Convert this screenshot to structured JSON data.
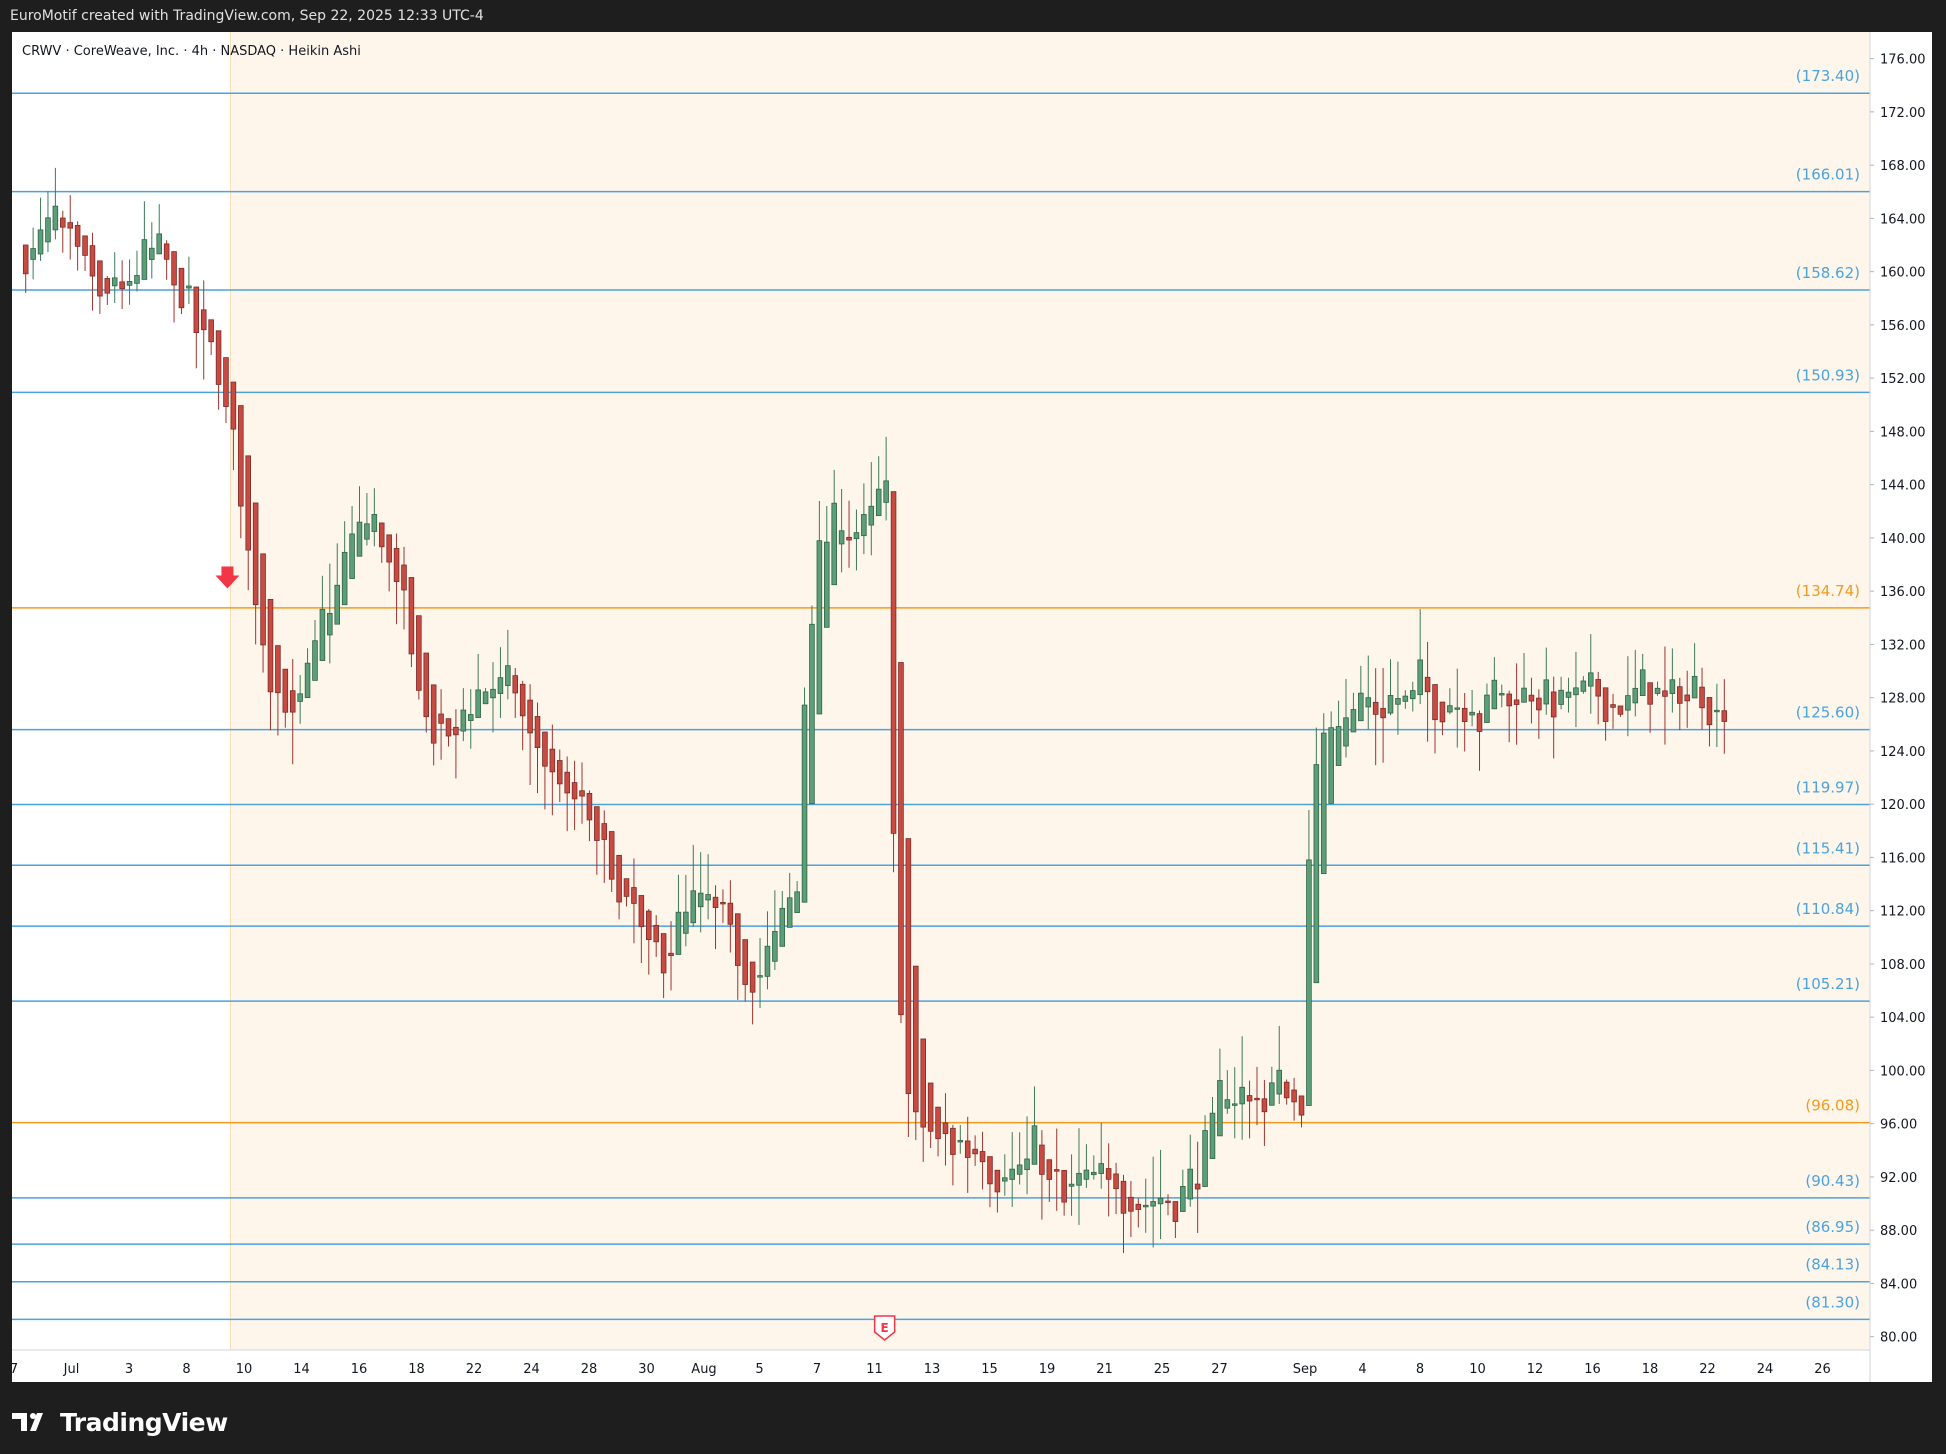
{
  "header": {
    "caption": "EuroMotif created with TradingView.com, Sep 22, 2025 12:33 UTC-4"
  },
  "symbol_line": "CRWV · CoreWeave, Inc. · 4h · NASDAQ · Heikin Ashi",
  "footer": {
    "brand": "TradingView"
  },
  "colors": {
    "background": "#ffffff",
    "frame": "#1e1e1e",
    "highlight_zone": "#fff6eb",
    "level_blue": "#4aa3df",
    "level_orange": "#f59a1e",
    "candle_up": "#5b9e78",
    "candle_down": "#c84b43",
    "signal_arrow": "#f23645"
  },
  "chart_data": {
    "type": "candlestick",
    "title": "CRWV · CoreWeave, Inc. · 4h · NASDAQ · Heikin Ashi",
    "candle_style": "Heikin Ashi",
    "interval": "4h",
    "ylim": [
      79,
      178
    ],
    "y_ticks": [
      "176.00",
      "172.00",
      "168.00",
      "164.00",
      "160.00",
      "156.00",
      "152.00",
      "148.00",
      "144.00",
      "140.00",
      "136.00",
      "132.00",
      "128.00",
      "124.00",
      "120.00",
      "116.00",
      "112.00",
      "108.00",
      "104.00",
      "100.00",
      "96.00",
      "92.00",
      "88.00",
      "84.00",
      "80.00"
    ],
    "x_ticks": [
      "7",
      "Jul",
      "3",
      "8",
      "10",
      "14",
      "16",
      "18",
      "22",
      "24",
      "28",
      "30",
      "Aug",
      "5",
      "7",
      "11",
      "13",
      "15",
      "19",
      "21",
      "25",
      "27",
      "Sep",
      "4",
      "8",
      "10",
      "12",
      "16",
      "18",
      "22",
      "24",
      "26"
    ],
    "levels": [
      {
        "value": 173.4,
        "label": "(173.40)",
        "color": "blue"
      },
      {
        "value": 166.01,
        "label": "(166.01)",
        "color": "blue"
      },
      {
        "value": 158.62,
        "label": "(158.62)",
        "color": "blue"
      },
      {
        "value": 150.93,
        "label": "(150.93)",
        "color": "blue"
      },
      {
        "value": 134.74,
        "label": "(134.74)",
        "color": "orange"
      },
      {
        "value": 125.6,
        "label": "(125.60)",
        "color": "blue"
      },
      {
        "value": 119.97,
        "label": "(119.97)",
        "color": "blue"
      },
      {
        "value": 115.41,
        "label": "(115.41)",
        "color": "blue"
      },
      {
        "value": 110.84,
        "label": "(110.84)",
        "color": "blue"
      },
      {
        "value": 105.21,
        "label": "(105.21)",
        "color": "blue"
      },
      {
        "value": 96.08,
        "label": "(96.08)",
        "color": "orange"
      },
      {
        "value": 90.43,
        "label": "(90.43)",
        "color": "blue"
      },
      {
        "value": 86.95,
        "label": "(86.95)",
        "color": "blue"
      },
      {
        "value": 84.13,
        "label": "(84.13)",
        "color": "blue"
      },
      {
        "value": 81.3,
        "label": "(81.30)",
        "color": "blue"
      }
    ],
    "highlight_zone_from": "11",
    "signal_arrow": {
      "direction": "down",
      "price": 136.5
    },
    "earnings_marker": {
      "label": "E",
      "at": "12"
    },
    "anchors": [
      [
        "start",
        162
      ],
      [
        "Jul",
        163
      ],
      [
        "3",
        158
      ],
      [
        "4",
        157
      ],
      [
        "8",
        162
      ],
      [
        "9",
        158
      ],
      [
        "10",
        154
      ],
      [
        "11",
        145
      ],
      [
        "13",
        130
      ],
      [
        "14",
        126
      ],
      [
        "15",
        134
      ],
      [
        "16",
        141
      ],
      [
        "17",
        140
      ],
      [
        "18",
        128
      ],
      [
        "21",
        124
      ],
      [
        "22",
        128
      ],
      [
        "23",
        130
      ],
      [
        "24",
        124
      ],
      [
        "28",
        117
      ],
      [
        "29",
        112
      ],
      [
        "30",
        107
      ],
      [
        "31",
        111
      ],
      [
        "Aug",
        112
      ],
      [
        "5",
        106
      ],
      [
        "6",
        110
      ],
      [
        "7",
        113
      ],
      [
        "8",
        118
      ],
      [
        "11",
        130
      ],
      [
        "12",
        142
      ],
      [
        "13",
        133
      ],
      [
        "14",
        120
      ],
      [
        "15",
        100
      ],
      [
        "18",
        101
      ],
      [
        "19",
        93
      ],
      [
        "20",
        89
      ],
      [
        "21",
        90
      ],
      [
        "22",
        92
      ],
      [
        "25",
        91
      ],
      [
        "26",
        91
      ],
      [
        "27",
        96
      ],
      [
        "28",
        101
      ],
      [
        "29",
        102
      ],
      [
        "Sep",
        98
      ],
      [
        "3",
        93
      ],
      [
        "4",
        90
      ],
      [
        "5",
        88
      ],
      [
        "8",
        90
      ],
      [
        "9",
        97
      ],
      [
        "10",
        106
      ],
      [
        "11",
        117
      ],
      [
        "12",
        114
      ],
      [
        "15",
        117
      ],
      [
        "16",
        120
      ],
      [
        "17",
        119
      ],
      [
        "18",
        121
      ],
      [
        "19",
        122
      ],
      [
        "22",
        128
      ]
    ],
    "trading_days": [
      "start",
      "Jul",
      "3",
      "4",
      "8",
      "9",
      "10",
      "11",
      "13",
      "14",
      "15",
      "16",
      "17",
      "18",
      "21",
      "22",
      "23",
      "24",
      "25",
      "28",
      "29",
      "30",
      "31",
      "Aug",
      "5",
      "6",
      "7",
      "8",
      "11",
      "12",
      "13",
      "14",
      "15",
      "18",
      "19",
      "20",
      "21",
      "22",
      "25",
      "26",
      "27",
      "28",
      "29",
      "Sep",
      "3",
      "4",
      "5",
      "8",
      "9",
      "10",
      "11",
      "12",
      "15",
      "16",
      "17",
      "18",
      "19",
      "22"
    ],
    "bars_per_day": 4
  }
}
